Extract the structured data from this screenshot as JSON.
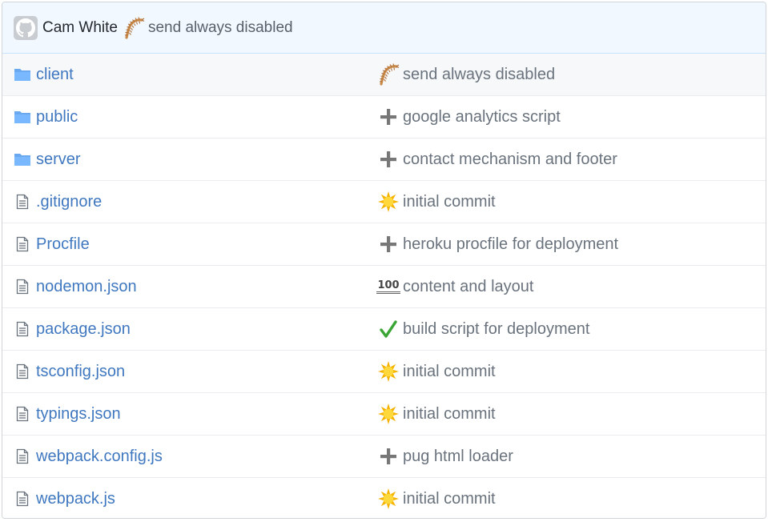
{
  "commit_bar": {
    "author": "Cam White",
    "emoji": "centipede-emoji",
    "message": "send always disabled"
  },
  "files": [
    {
      "type": "folder",
      "name": "client",
      "emoji": "centipede-emoji",
      "message": "send always disabled"
    },
    {
      "type": "folder",
      "name": "public",
      "emoji": "heavy-plus-emoji",
      "message": "google analytics script"
    },
    {
      "type": "folder",
      "name": "server",
      "emoji": "heavy-plus-emoji",
      "message": "contact mechanism and footer"
    },
    {
      "type": "file",
      "name": ".gitignore",
      "emoji": "sunburst-emoji",
      "message": "initial commit"
    },
    {
      "type": "file",
      "name": "Procfile",
      "emoji": "heavy-plus-emoji",
      "message": "heroku procfile for deployment"
    },
    {
      "type": "file",
      "name": "nodemon.json",
      "emoji": "hundred-points-emoji",
      "emoji_text": "100",
      "message": "content and layout"
    },
    {
      "type": "file",
      "name": "package.json",
      "emoji": "check-mark-emoji",
      "message": "build script for deployment"
    },
    {
      "type": "file",
      "name": "tsconfig.json",
      "emoji": "sunburst-emoji",
      "message": "initial commit"
    },
    {
      "type": "file",
      "name": "typings.json",
      "emoji": "sunburst-emoji",
      "message": "initial commit"
    },
    {
      "type": "file",
      "name": "webpack.config.js",
      "emoji": "heavy-plus-emoji",
      "message": "pug html loader"
    },
    {
      "type": "file",
      "name": "webpack.js",
      "emoji": "sunburst-emoji",
      "message": "initial commit"
    }
  ],
  "colors": {
    "link": "#4078c0",
    "muted": "#6a737d",
    "folder": "#79b8ff",
    "commit_bar_bg": "#f1f8ff"
  }
}
